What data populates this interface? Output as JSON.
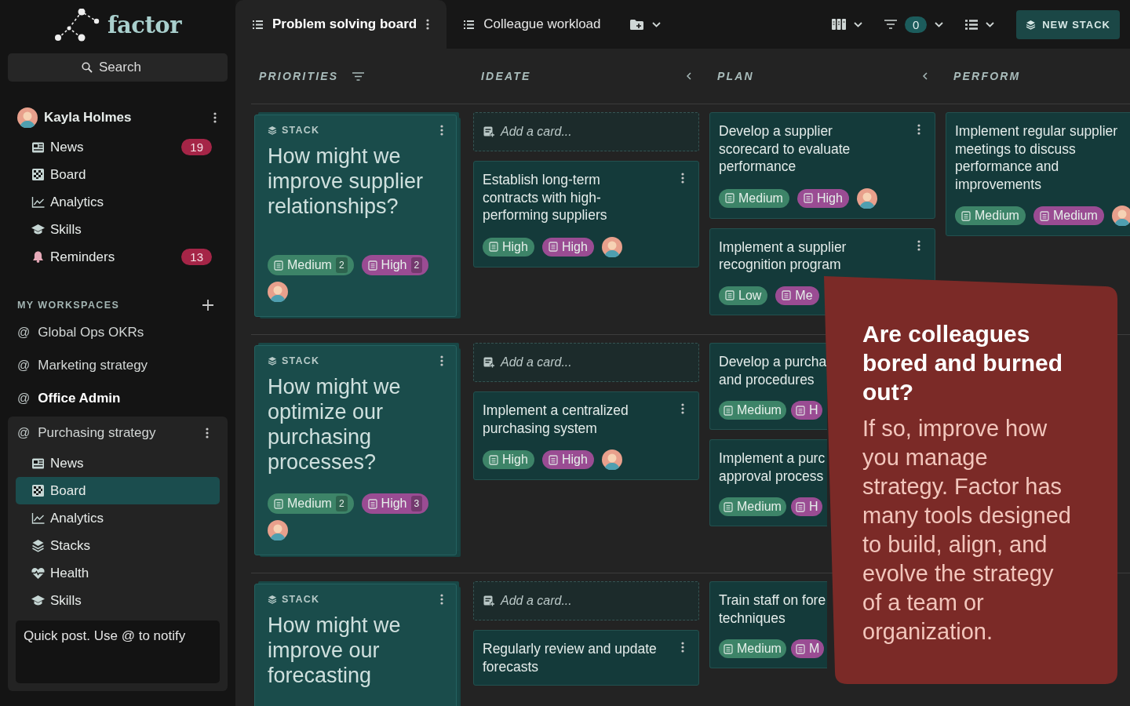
{
  "sidebar": {
    "logo": "factor",
    "search": {
      "placeholder": "Search"
    },
    "user": {
      "name": "Kayla Holmes",
      "items": [
        {
          "kind": "news",
          "label": "News",
          "count": "19",
          "selected": false
        },
        {
          "kind": "board",
          "label": "Board",
          "selected": false
        },
        {
          "kind": "analytics",
          "label": "Analytics",
          "selected": false
        },
        {
          "kind": "skills",
          "label": "Skills",
          "selected": false
        },
        {
          "kind": "reminders",
          "label": "Reminders",
          "count": "13",
          "selected": false
        }
      ]
    },
    "workspaces_heading": "MY WORKSPACES",
    "workspaces": [
      {
        "prefix": "@",
        "label": "Global Ops OKRs",
        "unread": false,
        "expanded": false
      },
      {
        "prefix": "@",
        "label": "Marketing strategy",
        "unread": false,
        "expanded": false
      },
      {
        "prefix": "@",
        "label": "Office Admin",
        "unread": true,
        "expanded": false
      },
      {
        "prefix": "@",
        "label": "Purchasing strategy",
        "unread": false,
        "expanded": true,
        "items": [
          {
            "kind": "news",
            "label": "News",
            "selected": false
          },
          {
            "kind": "board",
            "label": "Board",
            "selected": true
          },
          {
            "kind": "analytics",
            "label": "Analytics",
            "selected": false
          },
          {
            "kind": "stacks",
            "label": "Stacks",
            "selected": false
          },
          {
            "kind": "health",
            "label": "Health",
            "selected": false
          },
          {
            "kind": "skills",
            "label": "Skills",
            "selected": false
          }
        ]
      }
    ],
    "quick_post": {
      "placeholder": "Quick post. Use @ to notify"
    }
  },
  "tabs": [
    {
      "label": "Problem solving board",
      "selected": true
    },
    {
      "label": "Colleague workload",
      "selected": false
    }
  ],
  "toolbar": {
    "filter_count": "0",
    "new_stack": "NEW STACK"
  },
  "columns": [
    {
      "label": "PRIORITIES",
      "kind": "filter"
    },
    {
      "label": "IDEATE",
      "kind": "collapse"
    },
    {
      "label": "PLAN",
      "kind": "collapse"
    },
    {
      "label": "PERFORM",
      "kind": "plain"
    }
  ],
  "board": {
    "rows": [
      {
        "stack": {
          "label": "STACK",
          "lines": [
            "How might we",
            "improve supplier",
            "relationships?"
          ],
          "avatar": true,
          "tags": [
            {
              "label": "Medium",
              "count": "2",
              "color": "#3d8468"
            },
            {
              "label": "High",
              "count": "2",
              "color": "#9a4c93"
            }
          ]
        },
        "ideate": {
          "add_label": "Add a card...",
          "cards": [
            {
              "lines": [
                "Establish long-term",
                "contracts with high-",
                "performing suppliers"
              ],
              "menu": true,
              "avatar": true,
              "tags": [
                {
                  "label": "High",
                  "color": "#3d8468"
                },
                {
                  "label": "High",
                  "color": "#9a4c93"
                }
              ]
            }
          ]
        },
        "plan": {
          "cards": [
            {
              "lines": [
                "Develop a supplier",
                "scorecard to evaluate",
                "performance"
              ],
              "menu": true,
              "avatar": true,
              "tags": [
                {
                  "label": "Medium",
                  "color": "#3d8468"
                },
                {
                  "label": "High",
                  "color": "#9a4c93"
                }
              ]
            },
            {
              "lines": [
                "Implement a supplier",
                "recognition program"
              ],
              "menu": true,
              "avatar": false,
              "tags": [
                {
                  "label": "Low",
                  "color": "#3d8468"
                },
                {
                  "label": "Me",
                  "color": "#9a4c93"
                }
              ]
            }
          ]
        },
        "perform": {
          "cards": [
            {
              "lines": [
                "Implement regular supplier",
                "meetings to discuss",
                "performance and",
                "improvements"
              ],
              "menu": false,
              "avatar": true,
              "tags": [
                {
                  "label": "Medium",
                  "color": "#3d8468"
                },
                {
                  "label": "Medium",
                  "color": "#9a4c93"
                }
              ]
            }
          ]
        }
      },
      {
        "stack": {
          "label": "STACK",
          "lines": [
            "How might we",
            "optimize our",
            "purchasing",
            "processes?"
          ],
          "avatar": true,
          "tags": [
            {
              "label": "Medium",
              "count": "2",
              "color": "#3d8468"
            },
            {
              "label": "High",
              "count": "3",
              "color": "#9a4c93"
            }
          ]
        },
        "ideate": {
          "add_label": "Add a card...",
          "cards": [
            {
              "lines": [
                "Implement a centralized",
                "purchasing system"
              ],
              "menu": true,
              "avatar": true,
              "tags": [
                {
                  "label": "High",
                  "color": "#3d8468"
                },
                {
                  "label": "High",
                  "color": "#9a4c93"
                }
              ]
            }
          ]
        },
        "plan": {
          "cards": [
            {
              "lines": [
                "Develop a purcha",
                "and procedures"
              ],
              "menu": false,
              "avatar": false,
              "cut": true,
              "tags": [
                {
                  "label": "Medium",
                  "color": "#3d8468"
                },
                {
                  "label": "H",
                  "color": "#9a4c93"
                }
              ]
            },
            {
              "lines": [
                "Implement a purc",
                "approval process"
              ],
              "menu": false,
              "avatar": false,
              "cut": true,
              "tags": [
                {
                  "label": "Medium",
                  "color": "#3d8468"
                },
                {
                  "label": "H",
                  "color": "#9a4c93"
                }
              ]
            }
          ]
        },
        "perform": {}
      },
      {
        "stack": {
          "label": "STACK",
          "lines": [
            "How might we",
            "improve our",
            "forecasting"
          ],
          "avatar": false
        },
        "ideate": {
          "add_label": "Add a card...",
          "cards": [
            {
              "lines": [
                "Regularly review and update",
                "forecasts"
              ],
              "menu": true,
              "avatar": false
            }
          ]
        },
        "plan": {
          "cards": [
            {
              "lines": [
                "Train staff on fore",
                "techniques"
              ],
              "menu": false,
              "avatar": false,
              "cut": true,
              "tags": [
                {
                  "label": "Medium",
                  "color": "#3d8468"
                },
                {
                  "label": "M",
                  "color": "#9a4c93"
                }
              ]
            }
          ]
        },
        "perform": {}
      }
    ]
  },
  "callout": {
    "title": "Are colleagues bored and burned out?",
    "body": "If so, improve how you manage strategy. Factor has many tools designed to build, align, and evolve the strategy of a team or organization."
  }
}
